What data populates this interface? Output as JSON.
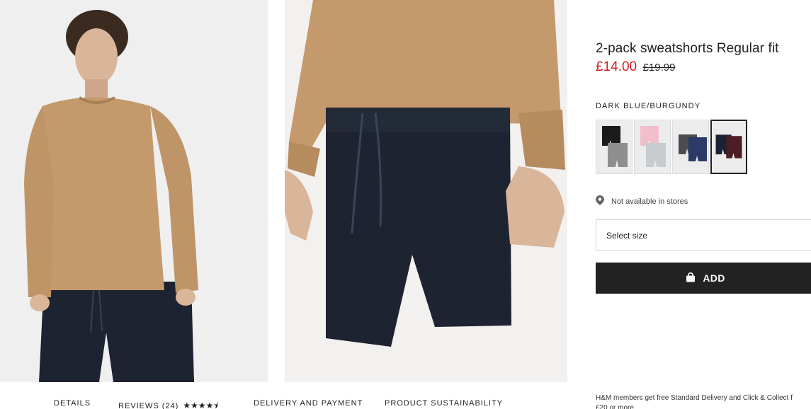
{
  "product": {
    "title": "2-pack sweatshorts Regular fit",
    "price_sale": "£14.00",
    "price_original": "£19.99",
    "color_label": "DARK BLUE/BURGUNDY",
    "swatches": [
      {
        "name": "black/grey",
        "colors": [
          "#1b1b1b",
          "#8e8e8e"
        ],
        "selected": false
      },
      {
        "name": "pink/light grey",
        "colors": [
          "#f1bfcc",
          "#c9ccce"
        ],
        "selected": false
      },
      {
        "name": "dark grey/blue",
        "colors": [
          "#4a4c50",
          "#2b3a66"
        ],
        "selected": false
      },
      {
        "name": "dark blue/burgundy",
        "colors": [
          "#1c2233",
          "#4b1d24"
        ],
        "selected": true
      }
    ],
    "availability": "Not available in stores",
    "size_placeholder": "Select size",
    "add_label": "ADD"
  },
  "tabs": {
    "details": "DETAILS",
    "reviews": "REVIEWS (24)",
    "reviews_stars": "★★★★⯨",
    "rating": 4.5,
    "delivery": "DELIVERY AND PAYMENT",
    "sustainability": "PRODUCT SUSTAINABILITY"
  },
  "promo": {
    "line1": "H&M members get free Standard Delivery and Click & Collect f",
    "line2": "£20 or more"
  },
  "colors": {
    "accent_sale": "#d41c24",
    "button_bg": "#222222",
    "sweater": "#c49a6c",
    "shorts": "#1d2330"
  }
}
